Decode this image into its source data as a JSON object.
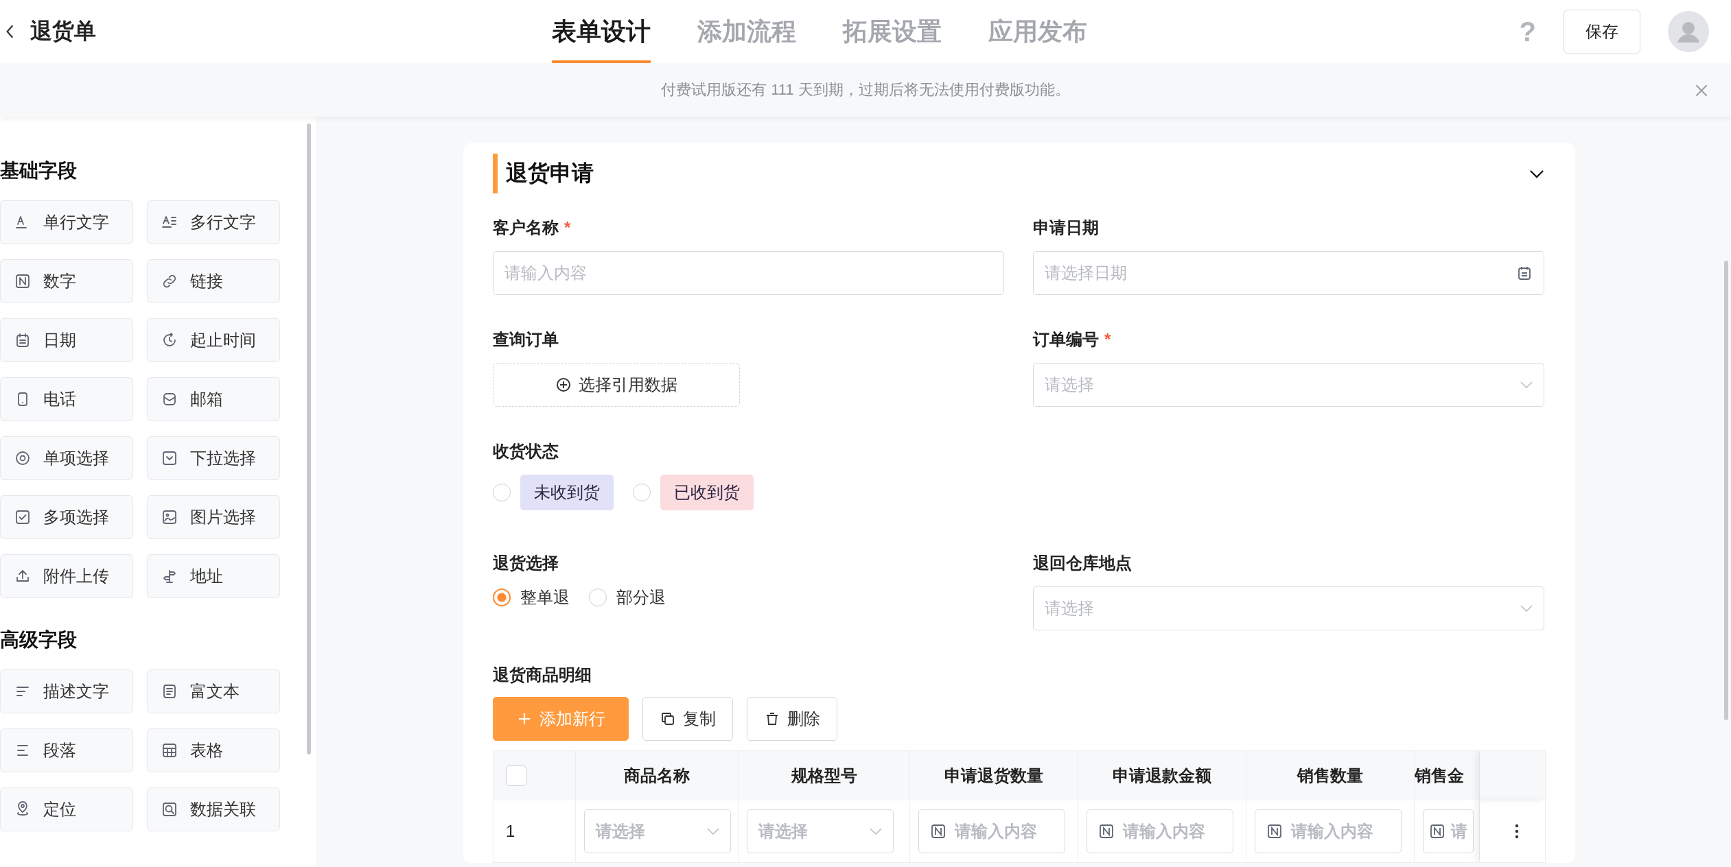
{
  "header": {
    "title": "退货单",
    "help": "?",
    "save_button": "保存"
  },
  "tabs": [
    {
      "label": "表单设计",
      "selected": true
    },
    {
      "label": "添加流程",
      "selected": false
    },
    {
      "label": "拓展设置",
      "selected": false
    },
    {
      "label": "应用发布",
      "selected": false
    }
  ],
  "notice": {
    "text": "付费试用版还有 111 天到期，过期后将无法使用付费版功能。"
  },
  "sidebar": {
    "groups": [
      {
        "title": "基础字段",
        "items": [
          {
            "label": "单行文字",
            "kind": "single-line"
          },
          {
            "label": "多行文字",
            "kind": "multi-line"
          },
          {
            "label": "数字",
            "kind": "number"
          },
          {
            "label": "链接",
            "kind": "link"
          },
          {
            "label": "日期",
            "kind": "date"
          },
          {
            "label": "起止时间",
            "kind": "time-range"
          },
          {
            "label": "电话",
            "kind": "phone"
          },
          {
            "label": "邮箱",
            "kind": "email"
          },
          {
            "label": "单项选择",
            "kind": "radio"
          },
          {
            "label": "下拉选择",
            "kind": "dropdown"
          },
          {
            "label": "多项选择",
            "kind": "checkbox"
          },
          {
            "label": "图片选择",
            "kind": "image"
          },
          {
            "label": "附件上传",
            "kind": "upload"
          },
          {
            "label": "地址",
            "kind": "address"
          }
        ]
      },
      {
        "title": "高级字段",
        "items": [
          {
            "label": "描述文字",
            "kind": "description"
          },
          {
            "label": "富文本",
            "kind": "rich-text"
          },
          {
            "label": "段落",
            "kind": "paragraph"
          },
          {
            "label": "表格",
            "kind": "table"
          },
          {
            "label": "定位",
            "kind": "location"
          },
          {
            "label": "数据关联",
            "kind": "data-link"
          }
        ]
      }
    ]
  },
  "form": {
    "title": "退货申请",
    "fields": [
      {
        "kind": "text",
        "label": "客户名称",
        "required_mark": "*",
        "placeholder": "请输入内容"
      },
      {
        "kind": "date",
        "label": "申请日期",
        "placeholder": "请选择日期"
      },
      {
        "kind": "reference",
        "label": "查询订单",
        "button": "选择引用数据"
      },
      {
        "kind": "select",
        "label": "订单编号",
        "required_mark": "*",
        "placeholder": "请选择"
      },
      {
        "kind": "tag-radio",
        "label": "收货状态",
        "options": [
          {
            "label": "未收到货",
            "color": "#e1e2f8",
            "selected": false
          },
          {
            "label": "已收到货",
            "color": "#fbdcdf",
            "selected": false
          }
        ]
      },
      {
        "kind": "radio",
        "label": "退货选择",
        "options": [
          {
            "label": "整单退",
            "selected": true
          },
          {
            "label": "部分退",
            "selected": false
          }
        ]
      },
      {
        "kind": "select",
        "label": "退回仓库地点",
        "placeholder": "请选择"
      },
      {
        "kind": "table",
        "label": "退货商品明细",
        "all_selected": false,
        "buttons": [
          {
            "label": "添加新行",
            "kind": "add"
          },
          {
            "label": "复制",
            "kind": "copy"
          },
          {
            "label": "删除",
            "kind": "delete"
          }
        ],
        "columns": [
          "商品名称",
          "规格型号",
          "申请退货数量",
          "申请退款金额",
          "销售数量",
          "销售金"
        ],
        "rows": [
          {
            "index": "1",
            "selected": false,
            "cells": [
              {
                "kind": "select",
                "placeholder": "请选择"
              },
              {
                "kind": "select",
                "placeholder": "请选择"
              },
              {
                "kind": "number",
                "placeholder": "请输入内容"
              },
              {
                "kind": "number",
                "placeholder": "请输入内容"
              },
              {
                "kind": "number",
                "placeholder": "请输入内容"
              },
              {
                "kind": "number",
                "placeholder": "请"
              }
            ]
          }
        ]
      }
    ]
  }
}
